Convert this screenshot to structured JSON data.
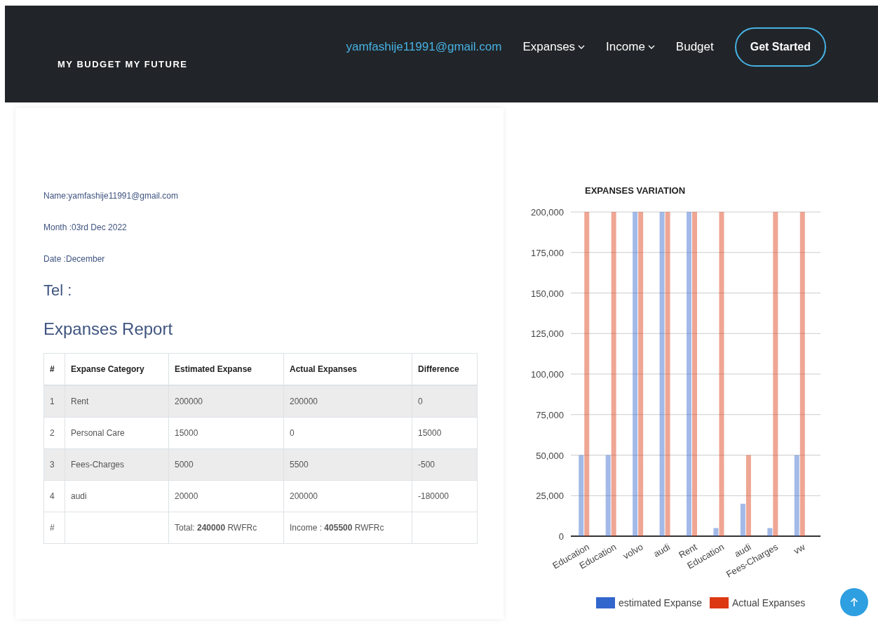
{
  "navbar": {
    "brand": "MY BUDGET MY FUTURE",
    "user_email": "yamfashije11991@gmail.com",
    "menu": [
      {
        "label": "Expanses",
        "kind": "dropdown"
      },
      {
        "label": "Income",
        "kind": "dropdown"
      },
      {
        "label": "Budget",
        "kind": "link"
      }
    ],
    "cta": "Get Started"
  },
  "report": {
    "info_lines": [
      "Name:yamfashije11991@gmail.com",
      "Month :03rd Dec 2022",
      "Date :December"
    ],
    "tel": "Tel :",
    "heading": "Expanses Report",
    "table": {
      "columns": [
        "#",
        "Expanse Category",
        "Estimated Expanse",
        "Actual Expanses",
        "Difference"
      ],
      "rows": [
        [
          "1",
          "Rent",
          "200000",
          "200000",
          "0"
        ],
        [
          "2",
          "Personal Care",
          "15000",
          "0",
          "15000"
        ],
        [
          "3",
          "Fees-Charges",
          "5000",
          "5500",
          "-500"
        ],
        [
          "4",
          "audi",
          "20000",
          "200000",
          "-180000"
        ]
      ],
      "footer": {
        "index": "#",
        "estimated": "Total: **240000** RWFRc",
        "actual": "Income : **405500** RWFRc"
      }
    }
  },
  "chart": {
    "chart_data": {
      "type": "bar",
      "title": "EXPANSES VARIATION",
      "grid": true,
      "legend": true,
      "categories": [
        "Education",
        "Education",
        "volvo",
        "audi",
        "Rent",
        "Education",
        "audi",
        "Fees-Charges",
        "vw"
      ],
      "series": [
        {
          "name": "estimated Expanse",
          "color": "#3366cc",
          "values": [
            50000,
            50000,
            200000,
            200000,
            200000,
            5000,
            20000,
            5000,
            50000
          ]
        },
        {
          "name": "Actual Expanses",
          "color": "#dc3912",
          "values": [
            200000,
            200000,
            200000,
            200000,
            200000,
            200000,
            50000,
            200000,
            200000
          ]
        }
      ],
      "ylim": [
        0,
        200000
      ],
      "yticks": [
        {
          "value": 0,
          "label": "0"
        },
        {
          "value": 25000,
          "label": "25,000"
        },
        {
          "value": 50000,
          "label": "50,000"
        },
        {
          "value": 75000,
          "label": "75,000"
        },
        {
          "value": 100000,
          "label": "100,000"
        },
        {
          "value": 125000,
          "label": "125,000"
        },
        {
          "value": 150000,
          "label": "150,000"
        },
        {
          "value": 175000,
          "label": "175,000"
        },
        {
          "value": 200000,
          "label": "200,000"
        }
      ]
    }
  }
}
